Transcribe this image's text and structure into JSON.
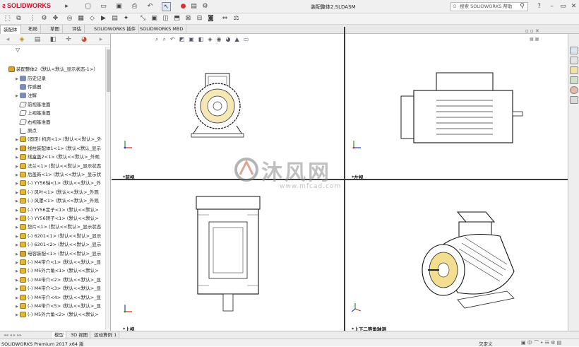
{
  "app": {
    "brand": "SOLIDWORKS",
    "brand_color": "#c8102e"
  },
  "titlebar": {
    "document_title": "装配整体2.SLDASM",
    "help_search_placeholder": "搜索 SOLIDWORKS 帮助",
    "buttons": [
      "new-icon",
      "open-icon",
      "save-icon",
      "print-icon",
      "undo-icon",
      "select-icon",
      "rebuild-icon",
      "file-properties-icon",
      "options-icon"
    ]
  },
  "tabs": [
    "装配体",
    "布局",
    "草图",
    "评估",
    "SOLIDWORKS 插件",
    "SOLIDWORKS MBD"
  ],
  "active_tab": "装配体",
  "feature_tree": {
    "root": "装配整体2（默认<默认_显示状态-1>）",
    "items": [
      {
        "label": "历史记录",
        "icon": "folder",
        "arrow": true
      },
      {
        "label": "传感器",
        "icon": "folder",
        "arrow": false
      },
      {
        "label": "注解",
        "icon": "folder",
        "arrow": true
      },
      {
        "label": "前视基准面",
        "icon": "plane",
        "arrow": false
      },
      {
        "label": "上视基准面",
        "icon": "plane",
        "arrow": false
      },
      {
        "label": "右视基准面",
        "icon": "plane",
        "arrow": false
      },
      {
        "label": "原点",
        "icon": "origin",
        "arrow": false
      },
      {
        "label": "(固定) 机壳<1> (默认<<默认>_外",
        "icon": "part",
        "arrow": true
      },
      {
        "label": "线柱装配体1<1> (默认<默认_显示",
        "icon": "asm",
        "arrow": true
      },
      {
        "label": "线盒盖2<1> (默认<<默认>_外观",
        "icon": "part",
        "arrow": true
      },
      {
        "label": "法兰<1> (默认<<默认>_显示状态",
        "icon": "part",
        "arrow": true
      },
      {
        "label": "后盖新<1> (默认<<默认>_显示状",
        "icon": "part",
        "arrow": true
      },
      {
        "label": "(-) YY56轴<1> (默认<<默认>_外",
        "icon": "part",
        "arrow": true
      },
      {
        "label": "(-) 风叶<1> (默认<<默认>_外观",
        "icon": "part",
        "arrow": true
      },
      {
        "label": "(-) 风罩<1> (默认<<默认>_外观",
        "icon": "part",
        "arrow": true
      },
      {
        "label": "(-) YY56定子<1> (默认<<默认>",
        "icon": "part",
        "arrow": true
      },
      {
        "label": "(-) YY56转子<1> (默认<<默认>",
        "icon": "part",
        "arrow": true
      },
      {
        "label": "垫片<1> (默认<<默认>_显示状态",
        "icon": "part",
        "arrow": true
      },
      {
        "label": "(-) 6201<1> (默认<<默认>_显示",
        "icon": "part",
        "arrow": true
      },
      {
        "label": "(-) 6201<2> (默认<<默认>_显示",
        "icon": "part",
        "arrow": true
      },
      {
        "label": "电容装配<1> (默认<<默认>_显示",
        "icon": "asm",
        "arrow": true
      },
      {
        "label": "(-) M4带介<1> (默认<<默认>_显",
        "icon": "part",
        "arrow": true
      },
      {
        "label": "(-) M5外六角<1> (默认<<默认>",
        "icon": "part",
        "arrow": true
      },
      {
        "label": "(-) M4带介<2> (默认<<默认>_显",
        "icon": "part",
        "arrow": true
      },
      {
        "label": "(-) M4带介<3> (默认<<默认>_显",
        "icon": "part",
        "arrow": true
      },
      {
        "label": "(-) M4带介<4> (默认<<默认>_显",
        "icon": "part",
        "arrow": true
      },
      {
        "label": "(-) M4带介<5> (默认<<默认>_显",
        "icon": "part",
        "arrow": true
      },
      {
        "label": "(-) M5外六角<2> (默认<<默认>",
        "icon": "part",
        "arrow": true
      }
    ]
  },
  "viewports": {
    "front": "*前视",
    "left": "*左视",
    "top": "*上视",
    "iso": "*上下二等角轴测"
  },
  "watermark": {
    "text": "沐风网",
    "url": "www.mfcad.com"
  },
  "bottom_tabs": [
    "模型",
    "3D 视图",
    "运动算例 1"
  ],
  "active_bottom_tab": "模型",
  "status": {
    "left": "SOLIDWORKS Premium 2017 x64 版",
    "right": "欠定义"
  }
}
